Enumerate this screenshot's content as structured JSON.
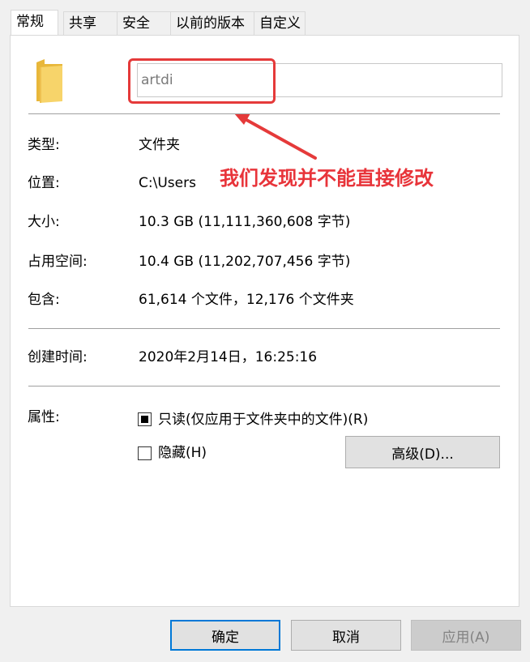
{
  "tabs": [
    {
      "label": "常规"
    },
    {
      "label": "共享"
    },
    {
      "label": "安全"
    },
    {
      "label": "以前的版本"
    },
    {
      "label": "自定义"
    }
  ],
  "folder": {
    "name_value": "artdi",
    "icon": "folder-icon",
    "icon_color": "#f2c94c"
  },
  "annotation": {
    "text": "我们发现并不能直接修改",
    "color": "#e8343a"
  },
  "properties": {
    "type_label": "类型:",
    "type_value": "文件夹",
    "location_label": "位置:",
    "location_value": "C:\\Users",
    "size_label": "大小:",
    "size_value": "10.3 GB (11,111,360,608 字节)",
    "disk_size_label": "占用空间:",
    "disk_size_value": "10.4 GB (11,202,707,456 字节)",
    "contains_label": "包含:",
    "contains_value": "61,614 个文件，12,176 个文件夹",
    "created_label": "创建时间:",
    "created_value": "2020年2月14日，16:25:16"
  },
  "attributes": {
    "label": "属性:",
    "readonly_label": "只读(仅应用于文件夹中的文件)(R)",
    "readonly_state": "indeterminate",
    "hidden_label": "隐藏(H)",
    "hidden_checked": false,
    "advanced_label": "高级(D)..."
  },
  "buttons": {
    "ok": "确定",
    "cancel": "取消",
    "apply": "应用(A)"
  }
}
